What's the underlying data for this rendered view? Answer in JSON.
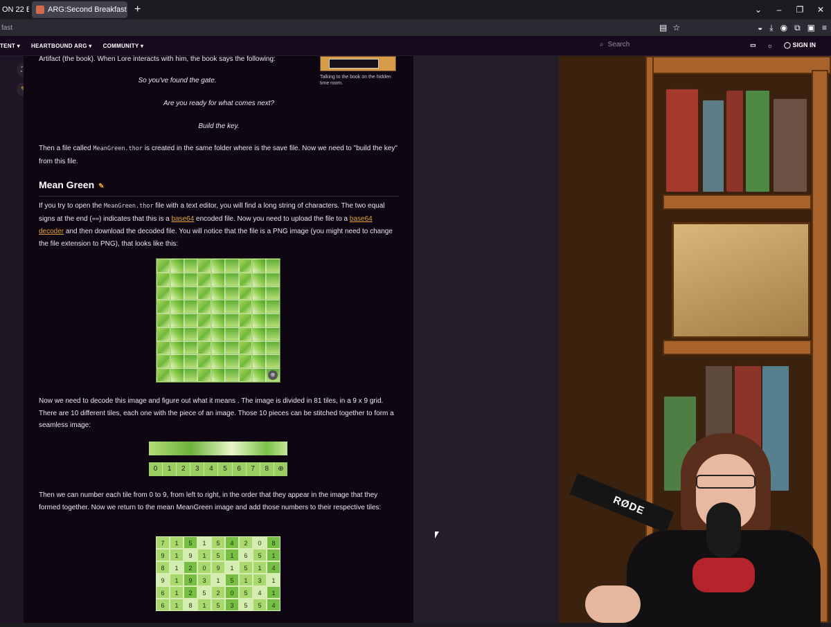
{
  "browser": {
    "tabs": [
      {
        "label": "ON 22 Ba"
      },
      {
        "label": "ARG:Second Breakfast | Heartb"
      }
    ],
    "url": "fast",
    "window_controls": [
      "⌄",
      "–",
      "❐",
      "✕"
    ]
  },
  "site_nav": {
    "items": [
      "TENT ▾",
      "HEARTBOUND ARG ▾",
      "COMMUNITY ▾"
    ],
    "search_placeholder": "Search",
    "sign_in": "SIGN IN"
  },
  "article": {
    "intro_fragment": "Artifact (the book). When Lore interacts with him, the book says the following:",
    "image_caption": "Talking to the book on the hidden time room.",
    "quote_lines": [
      "So you've found the gate.",
      "Are you ready for what comes next?",
      "Build the key."
    ],
    "para1_pre": "Then a file called ",
    "para1_code": "MeanGreen.thor",
    "para1_post": " is created in the same folder where is the save file. Now we need to \"build the key\" from this file.",
    "heading": "Mean Green",
    "para2_a": "If you try to open the ",
    "para2_code": "MeanGreen.thor",
    "para2_b": " file with a text editor, you will find a long string of characters. The two equal signs at the end (",
    "para2_code2": "==",
    "para2_c": ") indicates that this is a ",
    "para2_link1": "base64",
    "para2_d": " encoded file. Now you need to upload the file to a ",
    "para2_link2": "base64 decoder",
    "para2_e": " and then download the decoded file. You will notice that the file is a PNG image (you might need to change the file extension to PNG), that looks like this:",
    "para3": "Now we need to decode this image and figure out what it means . The image is divided in 81 tiles, in a 9 x 9 grid. There are 10 different tiles, each one with the piece of an image. Those 10 pieces can be stitched together to form a seamless image:",
    "strip_numbers": [
      "0",
      "1",
      "2",
      "3",
      "4",
      "5",
      "6",
      "7",
      "8"
    ],
    "para4": "Then we can number each tile from 0 to 9, from left to right, in the order that they appear in the image that they formed together. Now we return to the mean MeanGreen image and add those numbers to their respective tiles:",
    "number_grid": [
      [
        "7",
        "1",
        "5",
        "1",
        "5",
        "4",
        "2",
        "0",
        "8"
      ],
      [
        "9",
        "1",
        "9",
        "1",
        "5",
        "1",
        "6",
        "5",
        "1"
      ],
      [
        "8",
        "1",
        "2",
        "0",
        "9",
        "1",
        "5",
        "1",
        "4"
      ],
      [
        "9",
        "1",
        "9",
        "3",
        "1",
        "5",
        "1",
        "3",
        "1"
      ],
      [
        "6",
        "1",
        "2",
        "5",
        "2",
        "0",
        "5",
        "4",
        "1"
      ],
      [
        "6",
        "1",
        "8",
        "1",
        "5",
        "3",
        "5",
        "5",
        "4"
      ]
    ]
  },
  "stream": {
    "mic_brand": "RØDE"
  }
}
